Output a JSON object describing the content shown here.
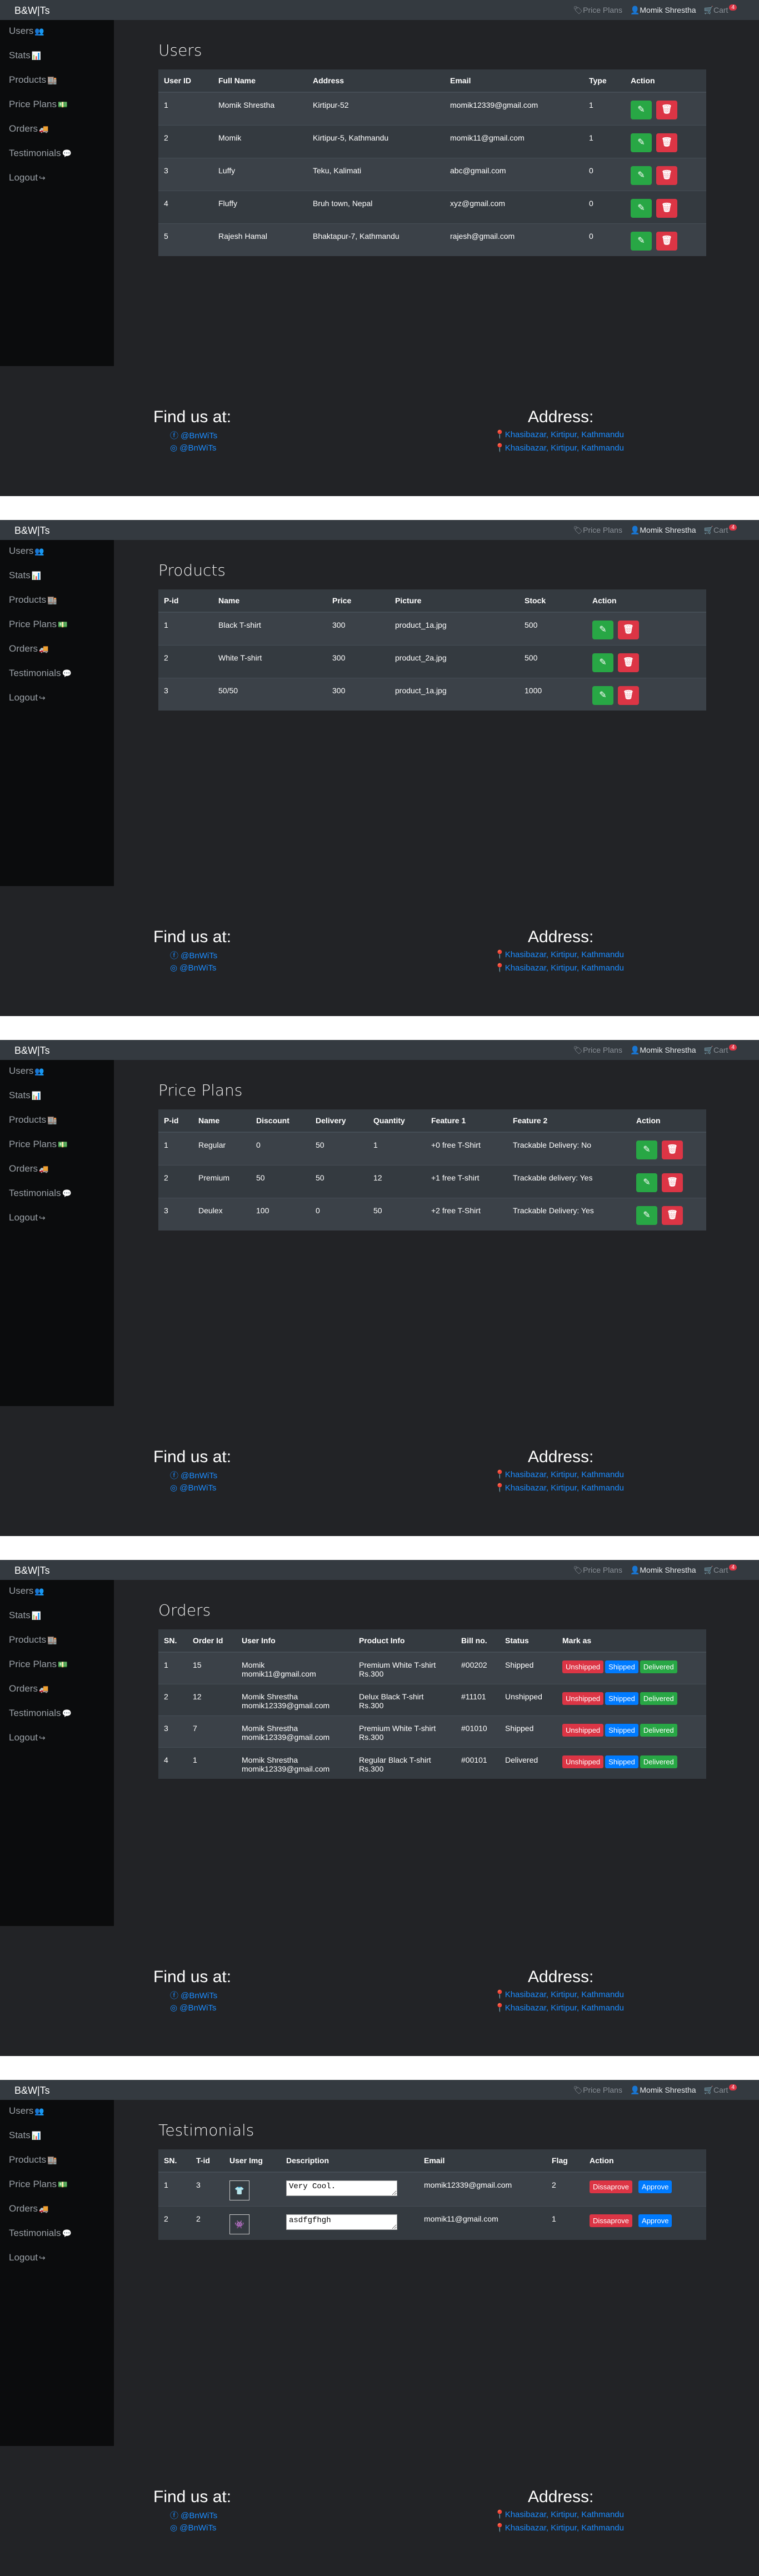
{
  "nav": {
    "brand": "B&W|Ts",
    "price_plans": "Price Plans",
    "user": "Momik Shrestha",
    "cart": "Cart",
    "cart_count": "4"
  },
  "sidebar": {
    "items": [
      {
        "label": "Users",
        "icon": "users-icon"
      },
      {
        "label": "Stats",
        "icon": "chart-icon"
      },
      {
        "label": "Products",
        "icon": "products-icon"
      },
      {
        "label": "Price Plans",
        "icon": "money-icon"
      },
      {
        "label": "Orders",
        "icon": "truck-icon"
      },
      {
        "label": "Testimonials",
        "icon": "comment-icon"
      },
      {
        "label": "Logout",
        "icon": "logout-icon"
      }
    ]
  },
  "footer": {
    "find_title": "Find us at:",
    "social1": "@BnWiTs",
    "social2": "@BnWiTs",
    "address_title": "Address:",
    "address1": "Khasibazar, Kirtipur, Kathmandu",
    "address2": "Khasibazar, Kirtipur, Kathmandu"
  },
  "users": {
    "title": "Users",
    "headers": [
      "User ID",
      "Full Name",
      "Address",
      "Email",
      "Type",
      "Action"
    ],
    "rows": [
      [
        "1",
        "Momik Shrestha",
        "Kirtipur-52",
        "momik12339@gmail.com",
        "1"
      ],
      [
        "2",
        "Momik",
        "Kirtipur-5, Kathmandu",
        "momik11@gmail.com",
        "1"
      ],
      [
        "3",
        "Luffy",
        "Teku, Kalimati",
        "abc@gmail.com",
        "0"
      ],
      [
        "4",
        "Fluffy",
        "Bruh town, Nepal",
        "xyz@gmail.com",
        "0"
      ],
      [
        "5",
        "Rajesh Hamal",
        "Bhaktapur-7, Kathmandu",
        "rajesh@gmail.com",
        "0"
      ]
    ]
  },
  "products": {
    "title": "Products",
    "headers": [
      "P-id",
      "Name",
      "Price",
      "Picture",
      "Stock",
      "Action"
    ],
    "rows": [
      [
        "1",
        "Black T-shirt",
        "300",
        "product_1a.jpg",
        "500"
      ],
      [
        "2",
        "White T-shirt",
        "300",
        "product_2a.jpg",
        "500"
      ],
      [
        "3",
        "50/50",
        "300",
        "product_1a.jpg",
        "1000"
      ]
    ]
  },
  "plans": {
    "title": "Price Plans",
    "headers": [
      "P-id",
      "Name",
      "Discount",
      "Delivery",
      "Quantity",
      "Feature 1",
      "Feature 2",
      "Action"
    ],
    "rows": [
      [
        "1",
        "Regular",
        "0",
        "50",
        "1",
        "+0 free T-Shirt",
        "Trackable Delivery: No"
      ],
      [
        "2",
        "Premium",
        "50",
        "50",
        "12",
        "+1 free T-shirt",
        "Trackable delivery: Yes"
      ],
      [
        "3",
        "Deulex",
        "100",
        "0",
        "50",
        "+2 free T-Shirt",
        "Trackable Delivery: Yes"
      ]
    ]
  },
  "orders": {
    "title": "Orders",
    "headers": [
      "SN.",
      "Order Id",
      "User Info",
      "Product Info",
      "Bill no.",
      "Status",
      "Mark as"
    ],
    "mark_labels": [
      "Unshipped",
      "Shipped",
      "Delivered"
    ],
    "rows": [
      [
        "1",
        "15",
        "Momik",
        "momik11@gmail.com",
        "Premium White T-shirt",
        "Rs.300",
        "#00202",
        "Shipped"
      ],
      [
        "2",
        "12",
        "Momik Shrestha",
        "momik12339@gmail.com",
        "Delux Black T-shirt",
        "Rs.300",
        "#11101",
        "Unshipped"
      ],
      [
        "3",
        "7",
        "Momik Shrestha",
        "momik12339@gmail.com",
        "Premium White T-shirt",
        "Rs.300",
        "#01010",
        "Shipped"
      ],
      [
        "4",
        "1",
        "Momik Shrestha",
        "momik12339@gmail.com",
        "Regular Black T-shirt",
        "Rs.300",
        "#00101",
        "Delivered"
      ]
    ]
  },
  "testimonials": {
    "title": "Testimonials",
    "headers": [
      "SN.",
      "T-id",
      "User Img",
      "Description",
      "Email",
      "Flag",
      "Action"
    ],
    "disapprove": "Dissaprove",
    "approve": "Approve",
    "rows": [
      [
        "1",
        "3",
        "Very Cool.",
        "momik12339@gmail.com",
        "2"
      ],
      [
        "2",
        "2",
        "asdfgfhgh",
        "momik11@gmail.com",
        "1"
      ]
    ]
  }
}
